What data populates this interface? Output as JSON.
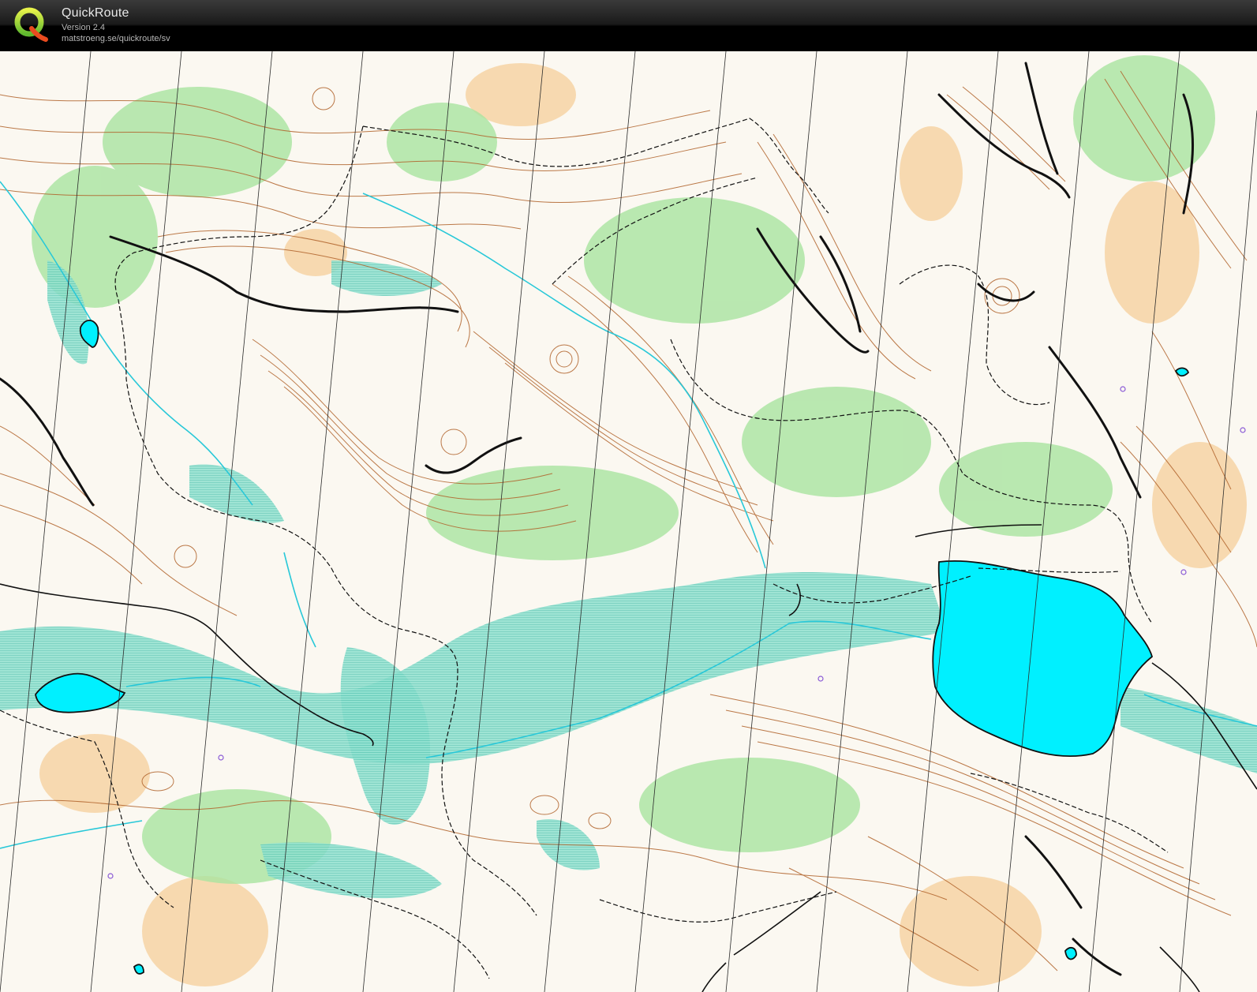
{
  "app": {
    "name": "QuickRoute",
    "version": "Version 2.4",
    "url": "matstroeng.se/quickroute/sv"
  },
  "colors": {
    "header_bg": "#000000",
    "map_bg": "#fbf8f1",
    "contour": "#b0622a",
    "vegetation_green": "#a9e3a0",
    "marsh_cyan": "#7fd8c9",
    "water": "#00f0ff",
    "open_land": "#f6c98f",
    "path_black": "#111111",
    "stream": "#28c8d8"
  },
  "icons": {
    "logo": "quickroute-logo-icon"
  }
}
